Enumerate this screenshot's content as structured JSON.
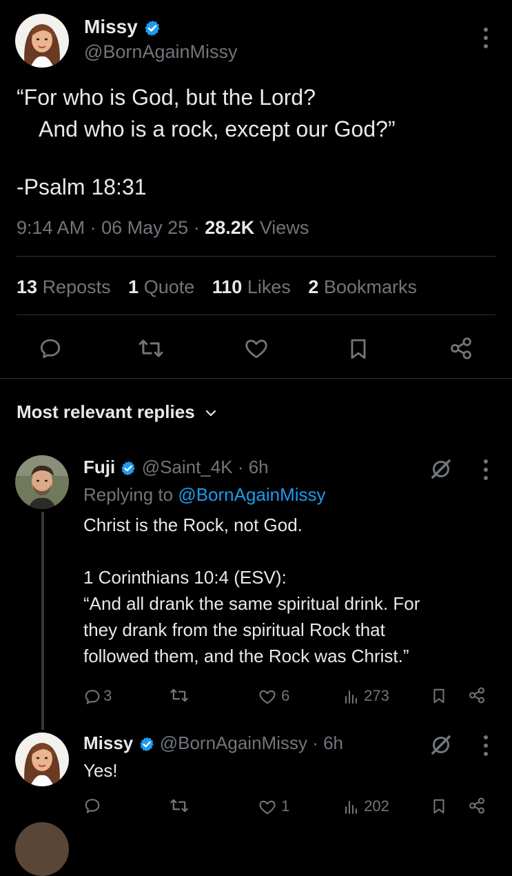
{
  "tweet": {
    "name": "Missy",
    "handle": "@BornAgainMissy",
    "lines": [
      "“For who is God, but the Lord?",
      "And who is a rock, except our God?”",
      "-Psalm 18:31"
    ],
    "time": "9:14 AM",
    "date": "06 May 25",
    "views_count": "28.2K",
    "views_label": "Views",
    "sep": "·",
    "stats": {
      "reposts_count": "13",
      "reposts_label": "Reposts",
      "quotes_count": "1",
      "quotes_label": "Quote",
      "likes_count": "110",
      "likes_label": "Likes",
      "bookmarks_count": "2",
      "bookmarks_label": "Bookmarks"
    }
  },
  "replies_header": "Most relevant replies",
  "replies": [
    {
      "name": "Fuji",
      "handle": "@Saint_4K",
      "age": "· 6h",
      "replying_prefix": "Replying to",
      "replying_handle": "@BornAgainMissy",
      "text_lines": [
        "Christ is the Rock, not God.",
        "1 Corinthians 10:4 (ESV):",
        "“And all drank the same spiritual drink. For",
        "they drank from the spiritual Rock that",
        "followed them, and the Rock was Christ.”"
      ],
      "comments": "3",
      "likes": "6",
      "views": "273"
    },
    {
      "name": "Missy",
      "handle": "@BornAgainMissy",
      "age": "· 6h",
      "text_lines": [
        "Yes!"
      ],
      "likes": "1",
      "views": "202"
    }
  ],
  "colors": {
    "accent": "#1d9bf0",
    "muted": "#71767b",
    "divider": "#2f3336"
  },
  "icons": [
    "verified-icon",
    "more-icon",
    "comment-icon",
    "repost-icon",
    "like-icon",
    "bookmark-icon",
    "share-icon",
    "chevron-down-icon",
    "grok-icon",
    "views-icon"
  ]
}
